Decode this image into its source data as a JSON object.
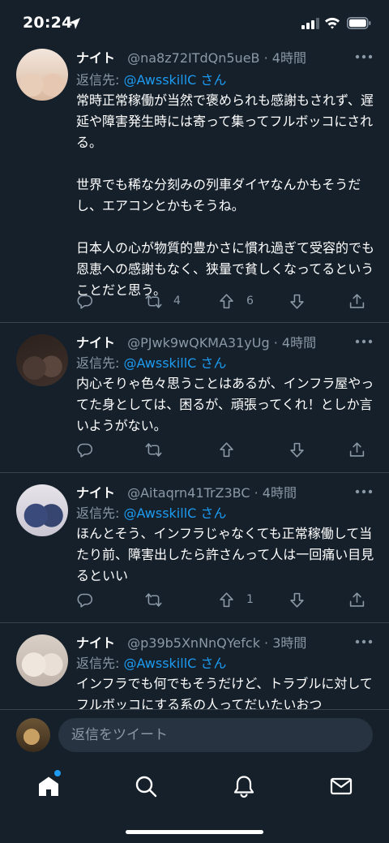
{
  "status_bar": {
    "time": "20:24"
  },
  "tweets": [
    {
      "name": "ナイト",
      "handle": "@na8z72ITdQn5ueB · 4時間",
      "reply_prefix": "返信先: ",
      "reply_to": "@AwsskillC",
      "reply_suffix": " さん",
      "text": "常時正常稼働が当然で褒められも感謝もされず、遅延や障害発生時には寄って集ってフルボッコにされる。\n\n世界でも稀な分刻みの列車ダイヤなんかもそうだし、エアコンとかもそうね。\n\n日本人の心が物質的豊かさに慣れ過ぎて受容的でも恩恵への感謝もなく、狭量で貧しくなってるということだと思う。",
      "retweets": "4",
      "upvotes": "6"
    },
    {
      "name": "ナイト",
      "handle": "@PJwk9wQKMA31yUg · 4時間",
      "reply_prefix": "返信先: ",
      "reply_to": "@AwsskillC",
      "reply_suffix": " さん",
      "text": "内心そりゃ色々思うことはあるが、インフラ屋やってた身としては、困るが、頑張ってくれ！としか言いようがない。",
      "retweets": "",
      "upvotes": ""
    },
    {
      "name": "ナイト",
      "handle": "@Aitaqrn41TrZ3BC · 4時間",
      "reply_prefix": "返信先: ",
      "reply_to": "@AwsskillC",
      "reply_suffix": " さん",
      "text": "ほんとそう、インフラじゃなくても正常稼働して当たり前、障害出したら許さんって人は一回痛い目見るといい",
      "retweets": "",
      "upvotes": "1"
    },
    {
      "name": "ナイト",
      "handle": "@p39b5XnNnQYefck · 3時間",
      "reply_prefix": "返信先: ",
      "reply_to": "@AwsskillC",
      "reply_suffix": " さん",
      "text": "インフラでも何でもそうだけど、トラブルに対してフルボッコにする系の人ってだいたいおつ",
      "retweets": "",
      "upvotes": ""
    }
  ],
  "reply_bar": {
    "placeholder": "返信をツイート"
  },
  "tabs": [
    {
      "icon": "home-icon"
    },
    {
      "icon": "search-icon"
    },
    {
      "icon": "bell-icon"
    },
    {
      "icon": "mail-icon"
    }
  ],
  "colors": {
    "background": "#15202b",
    "accent": "#1d9bf0",
    "secondary_text": "#8b98a5",
    "divider": "#38444d"
  }
}
